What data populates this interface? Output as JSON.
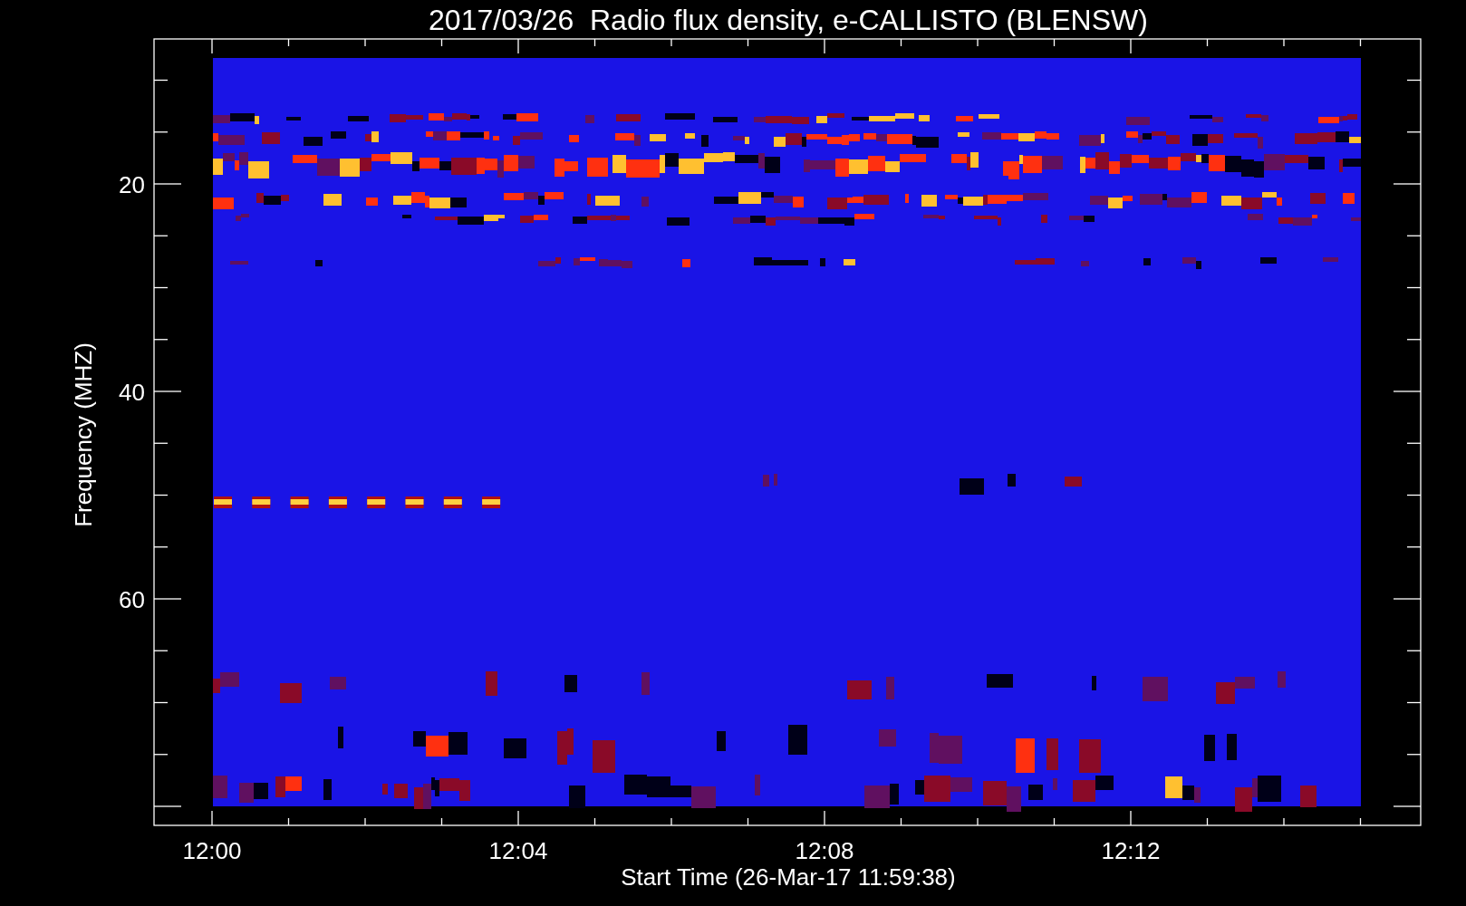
{
  "title": "2017/03/26  Radio flux density, e-CALLISTO (BLENSW)",
  "y_axis": {
    "label": "Frequency (MHZ)",
    "ticks": [
      "20",
      "40",
      "60"
    ]
  },
  "x_axis": {
    "label": "Start Time (26-Mar-17 11:59:38)",
    "ticks": [
      "12:00",
      "12:04",
      "12:08",
      "12:12"
    ]
  }
}
